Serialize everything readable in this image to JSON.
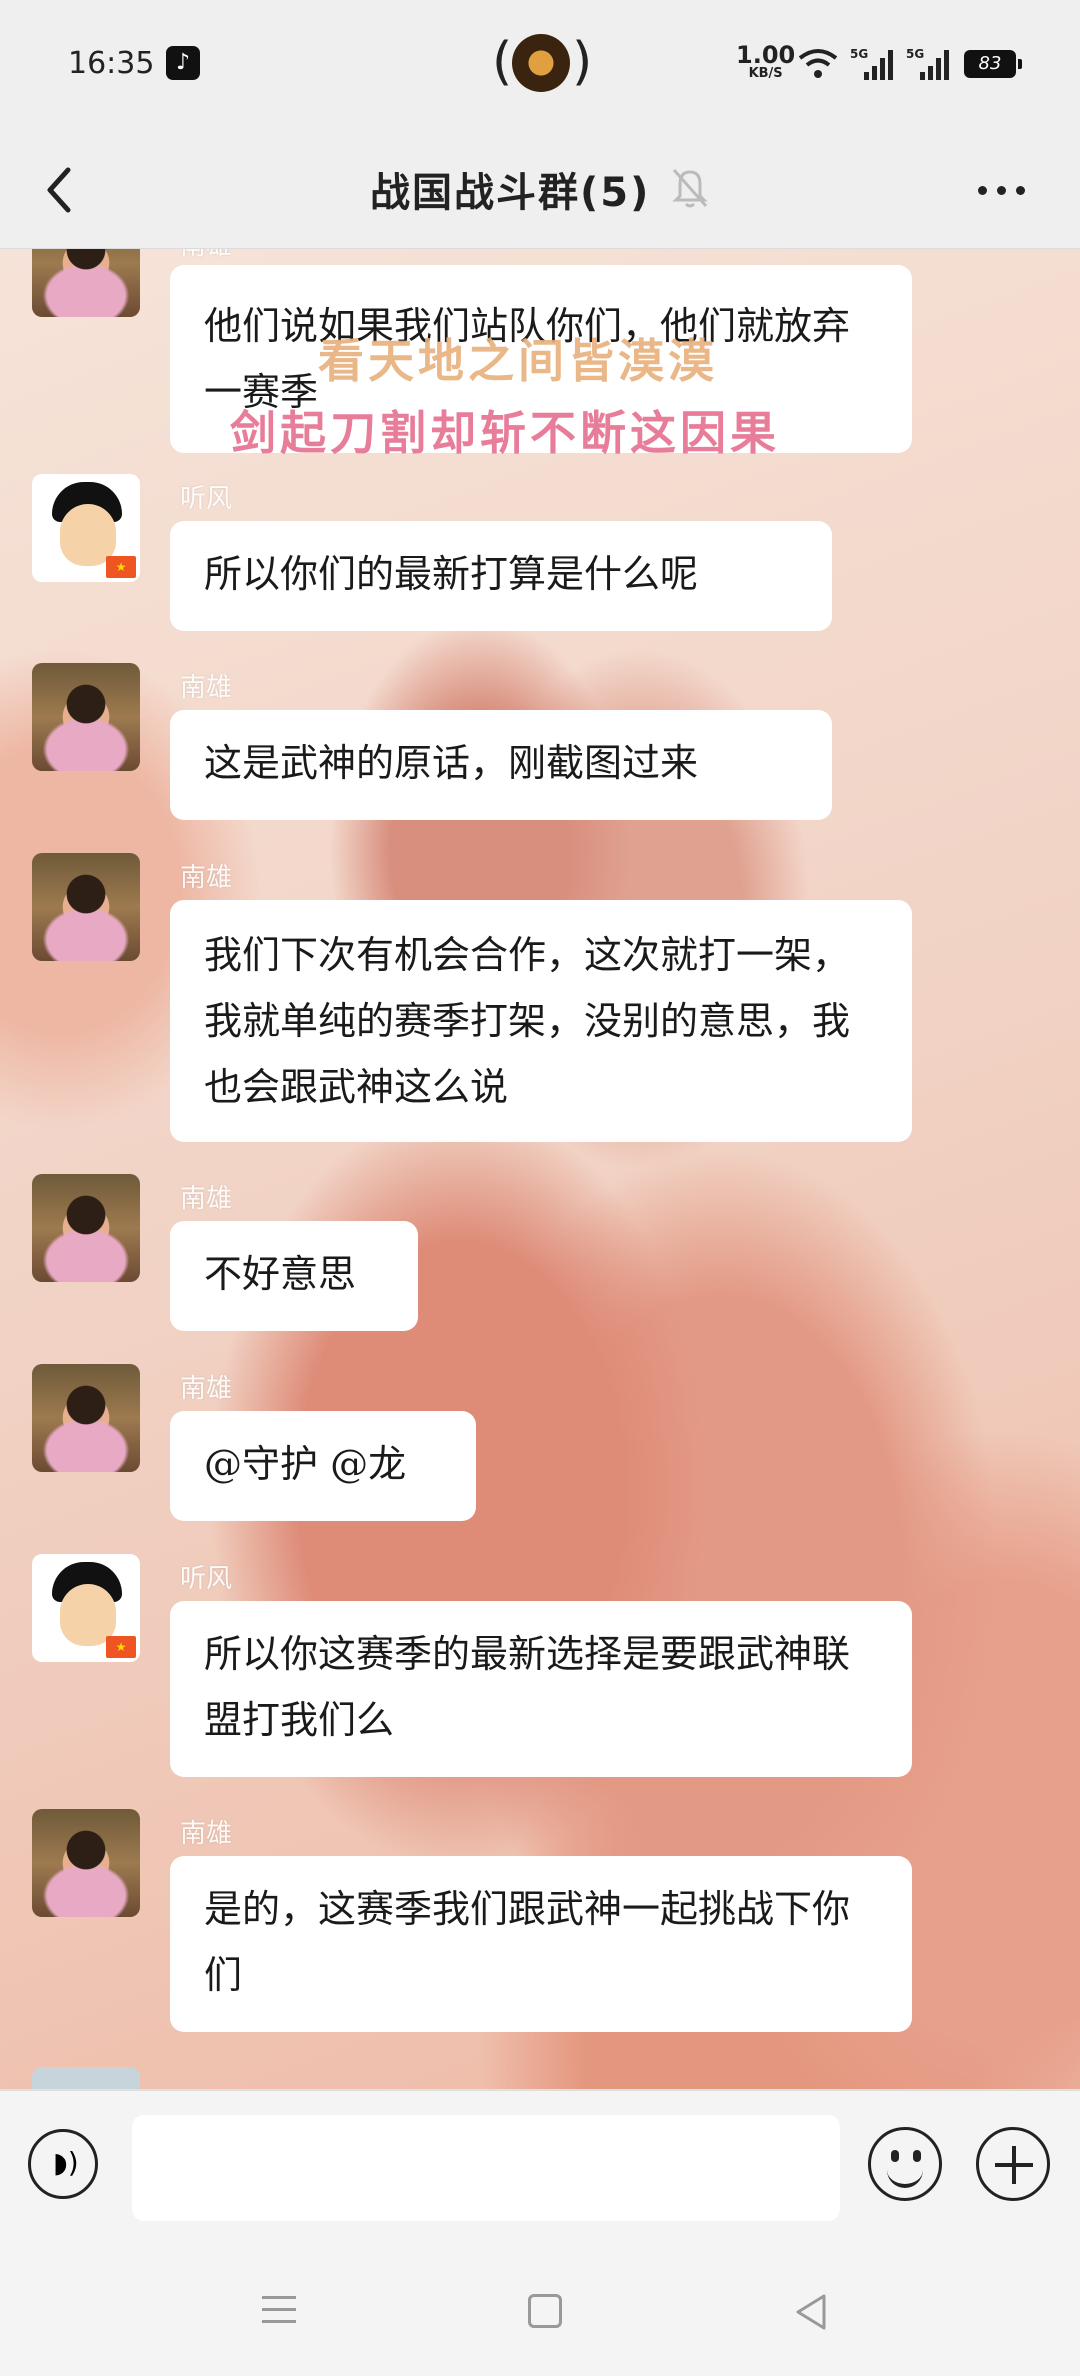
{
  "status_bar": {
    "time": "16:35",
    "network_speed": "1.00",
    "network_unit": "KB/S",
    "signal1": "5G",
    "signal2": "5G",
    "battery": "83"
  },
  "header": {
    "title": "战国战斗群(5)",
    "back_icon": "chevron-left-icon",
    "mute_icon": "bell-off-icon",
    "more_icon": "more-dots-icon"
  },
  "overlay": {
    "line1": "看天地之间皆漠漠",
    "line2": "剑起刀割却斩不断这因果"
  },
  "messages": [
    {
      "sender": "南雄",
      "text": "他们说如果我们站队你们，他们就放弃一赛季"
    },
    {
      "sender": "听风",
      "text": "所以你们的最新打算是什么呢"
    },
    {
      "sender": "南雄",
      "text": "这是武神的原话，刚截图过来"
    },
    {
      "sender": "南雄",
      "text": "我们下次有机会合作，这次就打一架，我就单纯的赛季打架，没别的意思，我也会跟武神这么说"
    },
    {
      "sender": "南雄",
      "text": "不好意思"
    },
    {
      "sender": "南雄",
      "text": "@守护 @龙"
    },
    {
      "sender": "听风",
      "text": "所以你这赛季的最新选择是要跟武神联盟打我们么"
    },
    {
      "sender": "南雄",
      "text": "是的，这赛季我们跟武神一起挑战下你们"
    }
  ],
  "input_bar": {
    "placeholder": "",
    "voice_icon": "voice-icon",
    "emoji_icon": "emoji-icon",
    "plus_icon": "plus-icon"
  }
}
